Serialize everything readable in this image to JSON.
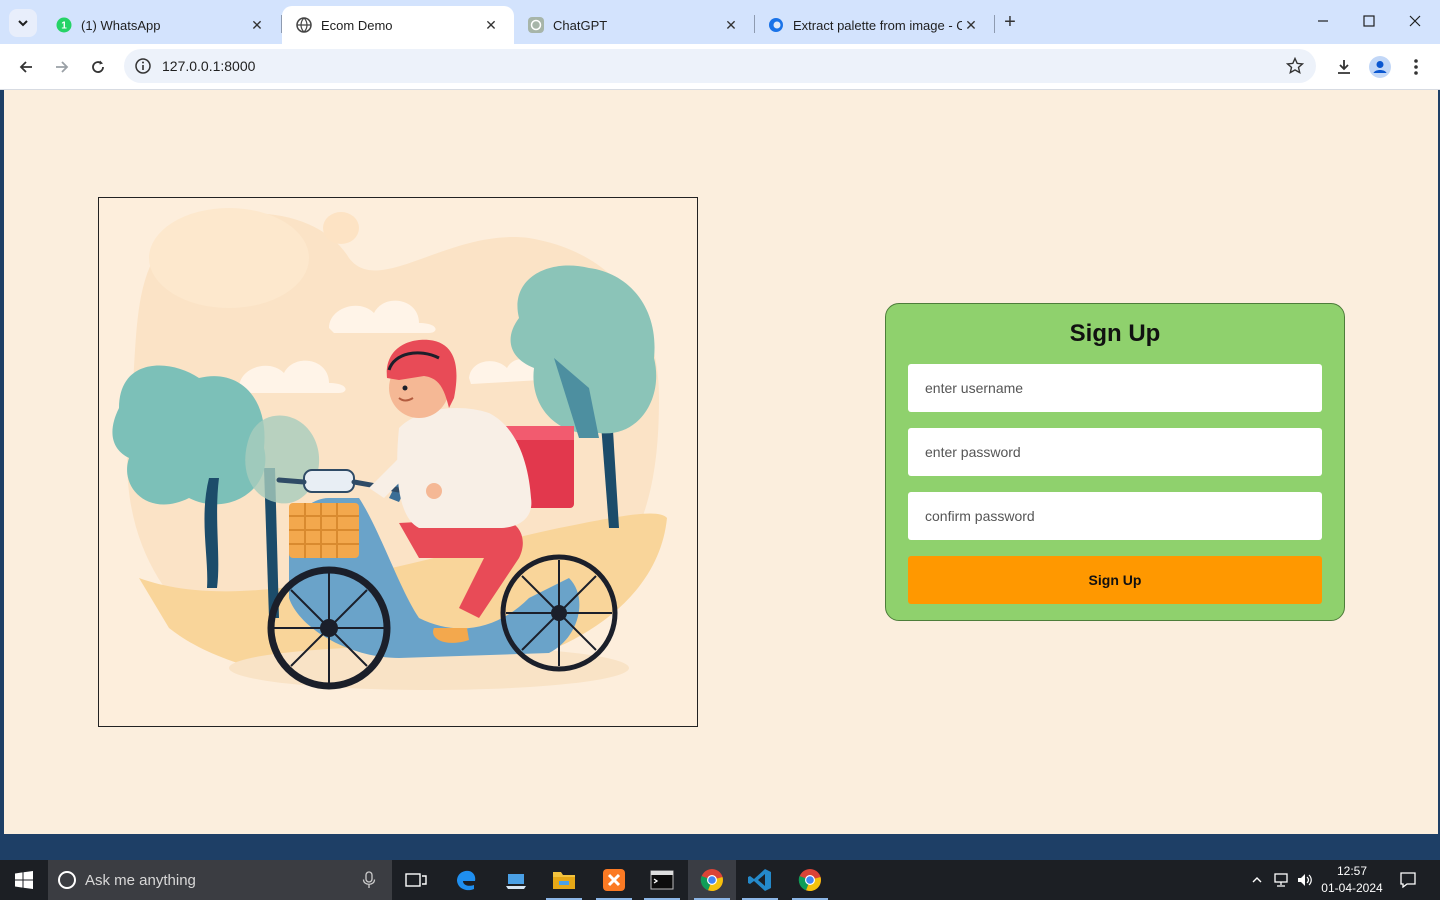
{
  "browser": {
    "tabs": [
      {
        "title": "(1) WhatsApp",
        "badge": "1",
        "active": false
      },
      {
        "title": "Ecom Demo",
        "active": true
      },
      {
        "title": "ChatGPT",
        "active": false
      },
      {
        "title": "Extract palette from image - Co",
        "active": false
      }
    ],
    "url": "127.0.0.1:8000"
  },
  "page": {
    "signup": {
      "title": "Sign Up",
      "username_placeholder": "enter username",
      "password_placeholder": "enter password",
      "confirm_placeholder": "confirm password",
      "button_label": "Sign Up"
    },
    "colors": {
      "background": "#fbeedd",
      "card": "#8fd16d",
      "button": "#ff9800"
    }
  },
  "taskbar": {
    "search_placeholder": "Ask me anything",
    "time": "12:57",
    "date": "01-04-2024"
  }
}
